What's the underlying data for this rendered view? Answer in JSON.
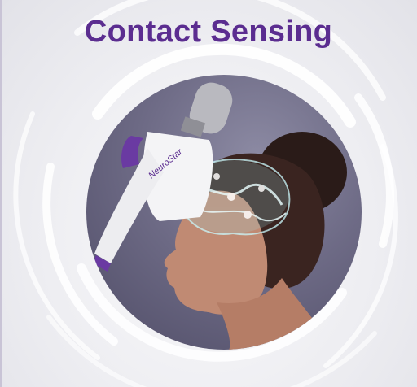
{
  "slide": {
    "title": "Contact Sensing",
    "device_logo": "NeuroStar",
    "colors": {
      "title": "#5b2d90",
      "device_accent": "#6a3aa2",
      "arc": "#ffffff",
      "brain_glow": "#bfeff4"
    }
  }
}
